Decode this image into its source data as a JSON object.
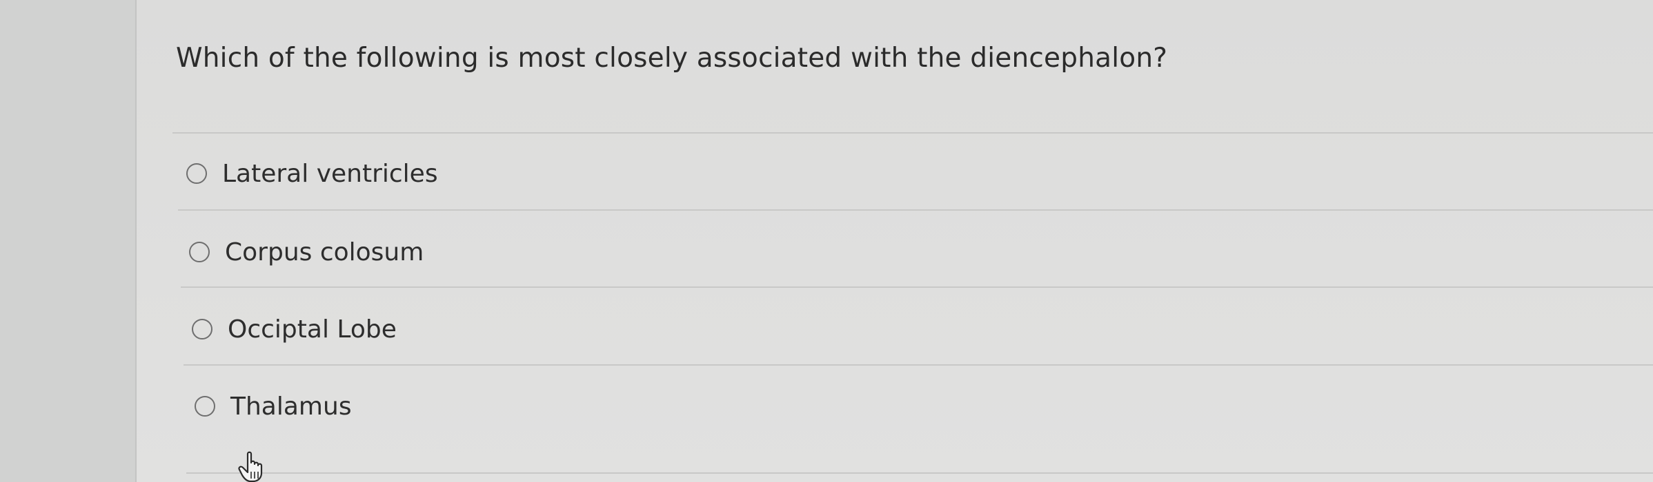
{
  "question": {
    "text": "Which of the following is most closely associated with the diencephalon?"
  },
  "options": [
    {
      "label": "Lateral ventricles",
      "selected": false
    },
    {
      "label": "Corpus colosum",
      "selected": false
    },
    {
      "label": "Occiptal Lobe",
      "selected": false
    },
    {
      "label": "Thalamus",
      "selected": false
    }
  ],
  "cursor": {
    "icon": "hand-pointer-icon"
  }
}
